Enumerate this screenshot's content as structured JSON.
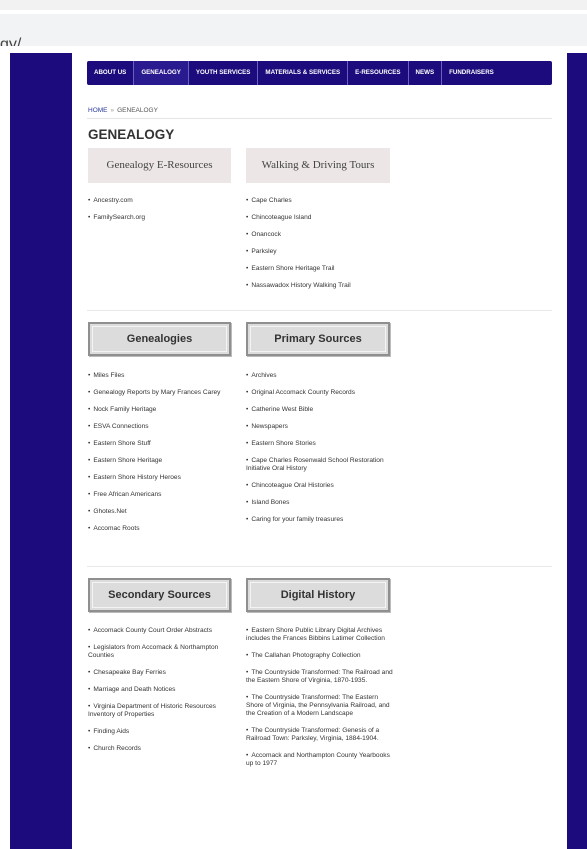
{
  "browser": {
    "url_fragment": "gy/"
  },
  "nav": {
    "items": [
      "ABOUT US",
      "GENEALOGY",
      "YOUTH SERVICES",
      "MATERIALS & SERVICES",
      "E-RESOURCES",
      "NEWS",
      "FUNDRAISERS"
    ],
    "active": "GENEALOGY"
  },
  "breadcrumb": {
    "home": "HOME",
    "sep": "»",
    "current": "GENEALOGY"
  },
  "page_title": "GENEALOGY",
  "sections": {
    "eresources": {
      "heading": "Genealogy E-Resources",
      "items": [
        "Ancestry.com",
        "FamilySearch.org"
      ]
    },
    "tours": {
      "heading": "Walking & Driving Tours",
      "items": [
        "Cape Charles",
        "Chincoteague Island",
        "Onancock",
        "Parksley",
        "Eastern Shore Heritage Trail",
        "Nassawadox History Walking Trail"
      ]
    },
    "genealogies": {
      "heading": "Genealogies",
      "items": [
        "Miles Files",
        "Genealogy Reports by Mary Frances Carey",
        "Nock Family Heritage",
        "ESVA Connections",
        "Eastern Shore Stuff",
        "Eastern Shore Heritage",
        "Eastern Shore History Heroes",
        "Free African Americans",
        "Ghotes.Net",
        "Accomac Roots"
      ]
    },
    "primary": {
      "heading": "Primary Sources",
      "items": [
        "Archives",
        "Original Accomack County Records",
        "Catherine West Bible",
        "Newspapers",
        "Eastern Shore Stories",
        "Cape Charles Rosenwald School Restoration Initiative Oral History",
        "Chincoteague Oral Histories",
        "Island Bones",
        "Caring for your family treasures"
      ]
    },
    "secondary": {
      "heading": "Secondary Sources",
      "items": [
        "Accomack County Court Order Abstracts",
        "Legislators from Accomack & Northampton Counties",
        "Chesapeake Bay Ferries",
        "Marriage and Death Notices",
        "Virginia Department of Historic Resources Inventory of Properties",
        "Finding Aids",
        "Church Records"
      ]
    },
    "digital": {
      "heading": "Digital History",
      "items": [
        "Eastern Shore Public Library Digital Archives includes the Frances Bibbins Latimer Collection",
        "The Callahan Photography Collection",
        "The Countryside Transformed: The Railroad and the Eastern Shore of Virginia, 1870-1935.",
        "The Countryside Transformed: The Eastern Shore of Virginia, the Pennsylvania Railroad, and the Creation of a Modern Landscape",
        "The Countryside Transformed: Genesis of a Railroad Town: Parksley, Virginia, 1884-1904.",
        "Accomack and Northampton County Yearbooks up to 1977"
      ]
    }
  },
  "colors": {
    "nav_bg": "#1b0b7c",
    "side_bg": "#1b0b7c",
    "heading_box": "#ece6e6"
  }
}
